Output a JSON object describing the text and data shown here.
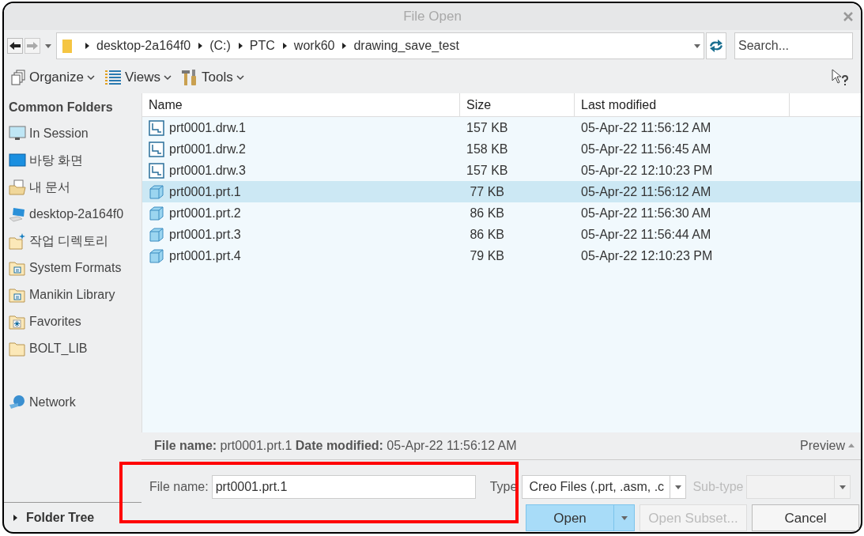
{
  "window": {
    "title": "File Open"
  },
  "address": {
    "crumbs": [
      "desktop-2a164f0",
      "(C:)",
      "PTC",
      "work60",
      "drawing_save_test"
    ]
  },
  "search": {
    "placeholder": "Search..."
  },
  "toolbar": [
    {
      "kind": "organize",
      "label": "Organize"
    },
    {
      "kind": "views",
      "label": "Views"
    },
    {
      "kind": "tools",
      "label": "Tools"
    }
  ],
  "sidebar": {
    "heading": "Common Folders",
    "items": [
      {
        "kind": "session",
        "label": "In Session"
      },
      {
        "kind": "desktop",
        "label": "바탕 화면"
      },
      {
        "kind": "documents",
        "label": "내 문서"
      },
      {
        "kind": "computer",
        "label": "desktop-2a164f0"
      },
      {
        "kind": "workdir",
        "label": "작업 디렉토리"
      },
      {
        "kind": "system",
        "label": "System Formats"
      },
      {
        "kind": "system",
        "label": "Manikin Library"
      },
      {
        "kind": "favorites",
        "label": "Favorites"
      },
      {
        "kind": "folder",
        "label": "BOLT_LIB"
      },
      {
        "kind": "network",
        "label": "Network"
      }
    ],
    "footer": "Folder Tree"
  },
  "table": {
    "columns": [
      "Name",
      "Size",
      "Last modified"
    ],
    "rows": [
      {
        "kind": "drawing",
        "name": "prt0001.drw.1",
        "size": "157 KB",
        "modified": "05-Apr-22 11:56:12 AM",
        "selected": false
      },
      {
        "kind": "drawing",
        "name": "prt0001.drw.2",
        "size": "158 KB",
        "modified": "05-Apr-22 11:56:45 AM",
        "selected": false
      },
      {
        "kind": "drawing",
        "name": "prt0001.drw.3",
        "size": "157 KB",
        "modified": "05-Apr-22 12:10:23 PM",
        "selected": false
      },
      {
        "kind": "part",
        "name": "prt0001.prt.1",
        "size": " 77 KB",
        "modified": "05-Apr-22 11:56:12 AM",
        "selected": true
      },
      {
        "kind": "part",
        "name": "prt0001.prt.2",
        "size": " 86 KB",
        "modified": "05-Apr-22 11:56:30 AM",
        "selected": false
      },
      {
        "kind": "part",
        "name": "prt0001.prt.3",
        "size": " 86 KB",
        "modified": "05-Apr-22 11:56:44 AM",
        "selected": false
      },
      {
        "kind": "part",
        "name": "prt0001.prt.4",
        "size": " 79 KB",
        "modified": "05-Apr-22 12:10:23 PM",
        "selected": false
      }
    ]
  },
  "info": {
    "text": "**File name:** prt0001.prt.1 **Date modified:** 05-Apr-22 11:56:12 AM",
    "preview": "Preview"
  },
  "file_name": {
    "label": "File name:",
    "value": "prt0001.prt.1"
  },
  "type": {
    "label": "Type",
    "value": "Creo Files (.prt, .asm, .c"
  },
  "subtype": {
    "label": "Sub-type",
    "disabled": true
  },
  "buttons": [
    {
      "kind": "split",
      "label": "Open",
      "disabled": false
    },
    {
      "kind": "plain",
      "label": "Open Subset...",
      "disabled": true
    },
    {
      "kind": "plain",
      "label": "Cancel",
      "disabled": false
    }
  ],
  "highlight": {
    "on": true
  }
}
